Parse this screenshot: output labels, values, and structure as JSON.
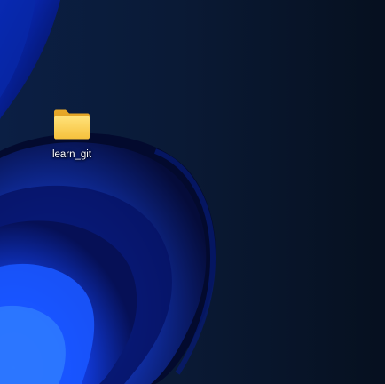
{
  "desktop": {
    "icons": [
      {
        "label": "learn_git",
        "icon": "folder-icon"
      }
    ]
  },
  "colors": {
    "background": "#071225",
    "bloom_blue": "#1a4cff",
    "folder_yellow": "#f8c94a"
  }
}
